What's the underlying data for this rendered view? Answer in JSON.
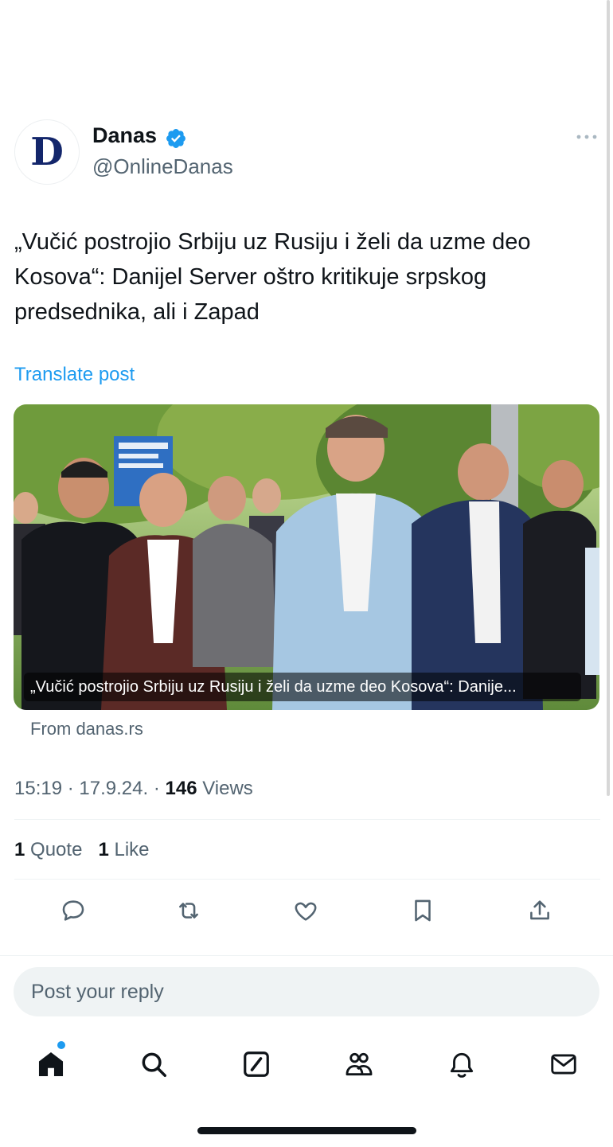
{
  "account": {
    "avatar_letter": "D",
    "display_name": "Danas",
    "handle": "@OnlineDanas",
    "verified": true
  },
  "tweet": {
    "text": "„Vučić postrojio Srbiju uz Rusiju i želi da uzme deo Kosova“: Danijel Server oštro kritikuje srpskog predsednika, ali i Zapad",
    "translate_label": "Translate post",
    "time": "15:19",
    "date": "17.9.24.",
    "views_count": "146",
    "views_label": "Views"
  },
  "link_card": {
    "caption": "„Vučić postrojio Srbiju uz Rusiju i želi da uzme deo Kosova“: Danije...",
    "source": "From danas.rs",
    "image_description_icon": "photo-icon"
  },
  "engagement": {
    "quote_count": "1",
    "quote_label": "Quote",
    "like_count": "1",
    "like_label": "Like"
  },
  "actions": [
    "reply-icon",
    "repost-icon",
    "like-icon",
    "bookmark-icon",
    "share-icon"
  ],
  "reply": {
    "placeholder": "Post your reply"
  },
  "bottom_nav": [
    "home-icon",
    "search-icon",
    "grok-icon",
    "communities-icon",
    "notifications-icon",
    "messages-icon"
  ],
  "colors": {
    "accent": "#1d9bf0",
    "text": "#0f1419",
    "secondary": "#536471",
    "logo": "#13266b"
  }
}
